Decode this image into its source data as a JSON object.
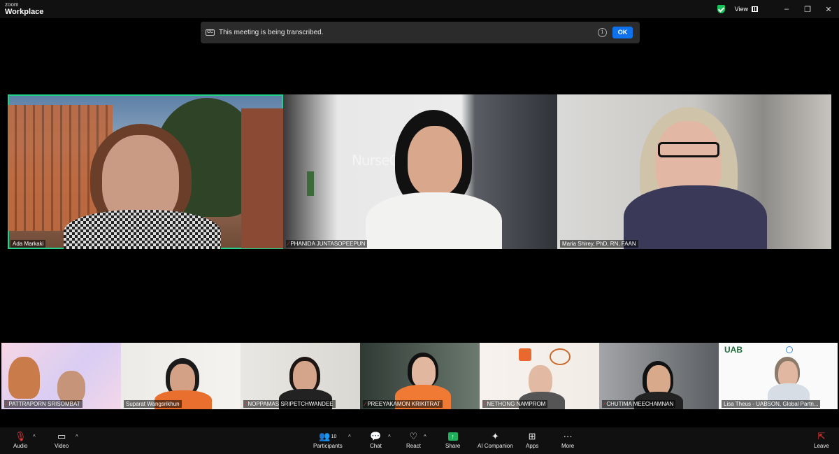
{
  "app": {
    "brand_small": "zoom",
    "brand_large": "Workplace",
    "view_label": "View",
    "window_controls": [
      "–",
      "❐",
      "✕"
    ]
  },
  "banner": {
    "text": "This meeting is being transcribed.",
    "cc": "CC",
    "ok_label": "OK"
  },
  "main_tiles": [
    {
      "name": "Ada Markaki",
      "muted": false
    },
    {
      "name": "PHANIDA JUNTASOPEEPUN",
      "muted": true,
      "bg_text": "NurseC"
    },
    {
      "name": "Maria Shirey, PhD, RN, FAAN",
      "muted": false
    }
  ],
  "strip_tiles": [
    {
      "name": "PATTRAPORN SRISOMBAT",
      "muted": true
    },
    {
      "name": "Suparat Wangsrikhun",
      "muted": false
    },
    {
      "name": "NOPPAMAS SRIPETCHWANDEE",
      "muted": true
    },
    {
      "name": "PREEYAKAMON KRIKITRAT",
      "muted": true
    },
    {
      "name": "NETHONG NAMPROM",
      "muted": true
    },
    {
      "name": "CHUTIMA MEECHAMNAN",
      "muted": true
    },
    {
      "name": "Lisa Theus - UABSON, Global Partn...",
      "muted": false,
      "logo_text": "UAB"
    }
  ],
  "toolbar": {
    "audio": "Audio",
    "video": "Video",
    "participants": "Participants",
    "participants_count": "10",
    "chat": "Chat",
    "react": "React",
    "share": "Share",
    "ai": "AI Companion",
    "apps": "Apps",
    "more": "More",
    "leave": "Leave"
  },
  "colors": {
    "active_speaker": "#23d18b",
    "ok_button": "#0e72ed",
    "share": "#21b05b",
    "muted_mic": "#e23b3b"
  }
}
